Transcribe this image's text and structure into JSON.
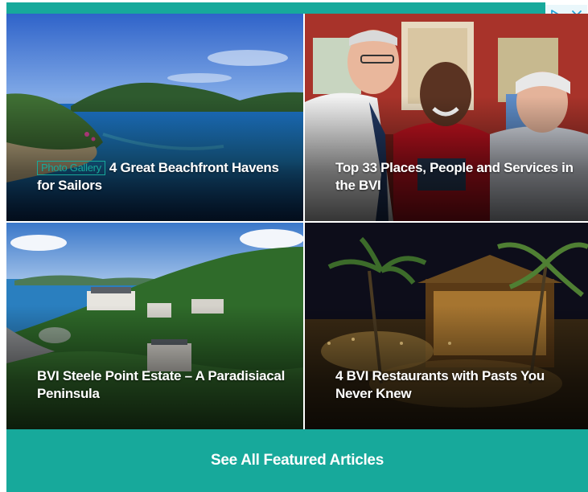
{
  "ad": {
    "accent_color": "#17a99b",
    "adchoices_icon": "adchoices-play-icon",
    "close_icon": "close-icon"
  },
  "tiles": [
    {
      "badge": "Photo Gallery",
      "title": "4 Great Beachfront Havens for Sailors",
      "image": "island-bay-aerial-image"
    },
    {
      "title": "Top 33 Places, People and Services in the BVI",
      "image": "three-men-portrait-image"
    },
    {
      "title": "BVI Steele Point Estate – A Paradisiacal Peninsula",
      "image": "peninsula-estate-aerial-image"
    },
    {
      "title": "4 BVI Restaurants with Pasts You Never Knew",
      "image": "restaurant-night-palms-image"
    }
  ],
  "cta": {
    "label": "See All Featured Articles"
  }
}
